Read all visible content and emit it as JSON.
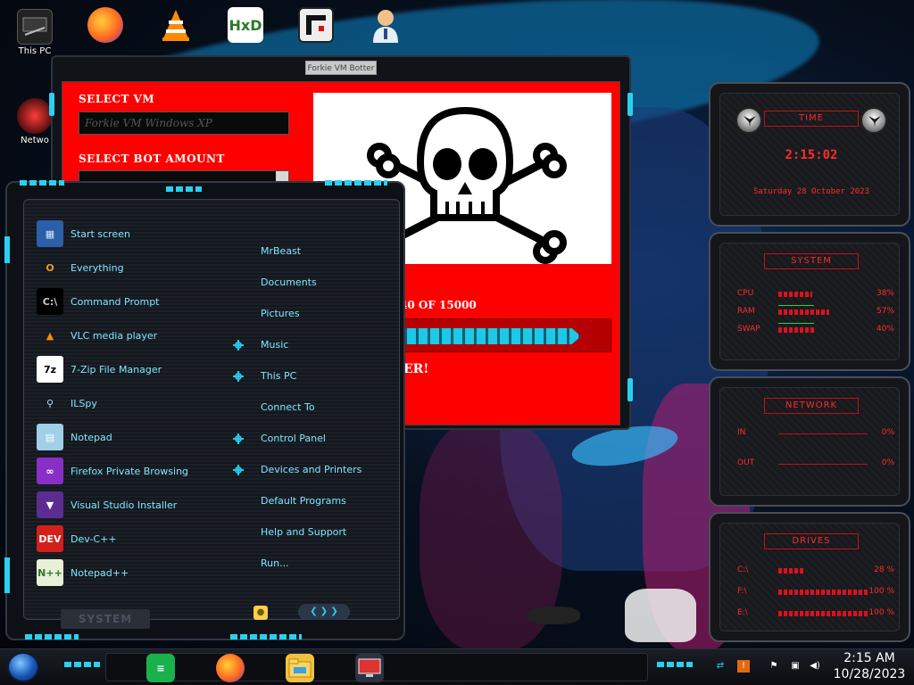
{
  "desktop": {
    "icons": [
      {
        "label": "This PC",
        "icon": "this-pc-icon"
      },
      {
        "label": "",
        "icon": "firefox-icon"
      },
      {
        "label": "",
        "icon": "vlc-icon"
      },
      {
        "label": "",
        "icon": "hxd-icon"
      },
      {
        "label": "",
        "icon": "app-icon"
      },
      {
        "label": "",
        "icon": "user-doctor-icon"
      },
      {
        "label": "Netwo",
        "icon": "network-icon"
      }
    ]
  },
  "bot_window": {
    "title": "Forkie VM Botter",
    "select_vm_label": "SELECT VM",
    "vm_value": "Forkie VM Windows XP",
    "select_bot_label": "SELECT BOT AMOUNT",
    "progress_text": "40 OF 15000",
    "progress_fraction": 0.91,
    "status_text": "ER!",
    "panel_color": "#ff0000"
  },
  "start_menu": {
    "programs": [
      {
        "label": "Start screen",
        "icon": "start-screen-icon",
        "glyph": "▦",
        "bg": "#2b5fa8",
        "fg": "#cfe6ff"
      },
      {
        "label": "Everything",
        "icon": "search-magnifier-icon",
        "glyph": "O",
        "bg": "transparent",
        "fg": "#f29a1f"
      },
      {
        "label": "Command Prompt",
        "icon": "terminal-icon",
        "glyph": "C:\\",
        "bg": "#000000",
        "fg": "#cccccc"
      },
      {
        "label": "VLC media player",
        "icon": "vlc-icon",
        "glyph": "▲",
        "bg": "transparent",
        "fg": "#ff8a00"
      },
      {
        "label": "7-Zip File Manager",
        "icon": "seven-zip-icon",
        "glyph": "7z",
        "bg": "#ffffff",
        "fg": "#000000"
      },
      {
        "label": "ILSpy",
        "icon": "ilspy-icon",
        "glyph": "⚲",
        "bg": "transparent",
        "fg": "#bcd7ef"
      },
      {
        "label": "Notepad",
        "icon": "notepad-icon",
        "glyph": "▤",
        "bg": "#9fd0e8",
        "fg": "#ffffff"
      },
      {
        "label": "Firefox Private Browsing",
        "icon": "firefox-private-icon",
        "glyph": "∞",
        "bg": "#8a2ec8",
        "fg": "#ffffff"
      },
      {
        "label": "Visual Studio Installer",
        "icon": "visual-studio-icon",
        "glyph": "▼",
        "bg": "#5c2d91",
        "fg": "#ffffff"
      },
      {
        "label": "Dev-C++",
        "icon": "devcpp-icon",
        "glyph": "DEV",
        "bg": "#d3201a",
        "fg": "#ffffff"
      },
      {
        "label": "Notepad++",
        "icon": "notepad-plus-icon",
        "glyph": "N++",
        "bg": "#e8f0d8",
        "fg": "#2a7a2a"
      }
    ],
    "places": [
      {
        "label": "MrBeast",
        "has_marker": false
      },
      {
        "label": "Documents",
        "has_marker": false
      },
      {
        "label": "Pictures",
        "has_marker": false
      },
      {
        "label": "Music",
        "has_marker": true
      },
      {
        "label": "This PC",
        "has_marker": true
      },
      {
        "label": "Connect To",
        "has_marker": false
      },
      {
        "label": "Control Panel",
        "has_marker": true
      },
      {
        "label": "Devices and Printers",
        "has_marker": true
      },
      {
        "label": "Default Programs",
        "has_marker": false
      },
      {
        "label": "Help and Support",
        "has_marker": false
      },
      {
        "label": "Run...",
        "has_marker": false
      }
    ],
    "system_label": "SYSTEM"
  },
  "widget": {
    "time": {
      "title": "TIME",
      "clock": "2:15:02",
      "date": "Saturday 28 October 2023"
    },
    "system": {
      "title": "SYSTEM",
      "rows": [
        {
          "key": "CPU",
          "value": "38%",
          "fraction": 0.38
        },
        {
          "key": "RAM",
          "value": "57%",
          "fraction": 0.57
        },
        {
          "key": "SWAP",
          "value": "40%",
          "fraction": 0.4
        }
      ]
    },
    "network": {
      "title": "NETWORK",
      "rows": [
        {
          "key": "IN",
          "value": "0%"
        },
        {
          "key": "OUT",
          "value": "0%"
        }
      ]
    },
    "drives": {
      "title": "DRIVES",
      "rows": [
        {
          "key": "C:\\",
          "value": "28 %",
          "fraction": 0.28
        },
        {
          "key": "F:\\",
          "value": "100 %",
          "fraction": 1.0
        },
        {
          "key": "E:\\",
          "value": "100 %",
          "fraction": 1.0
        }
      ]
    }
  },
  "taskbar": {
    "time": "2:15 AM",
    "date": "10/28/2023",
    "apps": [
      "sticky-notes-icon",
      "firefox-icon",
      "file-explorer-icon",
      "remote-desktop-icon"
    ]
  },
  "colors": {
    "accent_cyan": "#2ad0f0",
    "accent_red": "#ff2a2a",
    "bot_red": "#ff0000"
  }
}
